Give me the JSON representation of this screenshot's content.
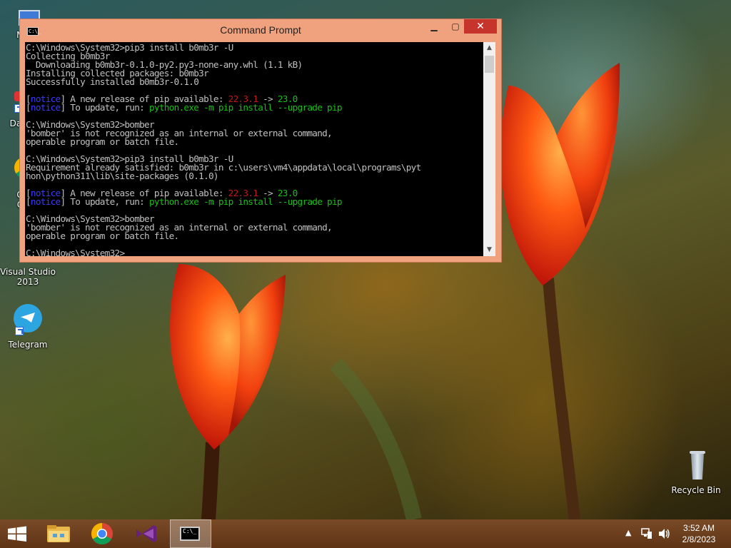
{
  "desktop": {
    "icons": [
      {
        "label": "My C"
      },
      {
        "label": "Data"
      },
      {
        "label": "G"
      },
      {
        "label": "C"
      },
      {
        "label": "Visual Studio"
      },
      {
        "label": "2013"
      },
      {
        "label": "Telegram"
      },
      {
        "label": "Recycle Bin"
      }
    ]
  },
  "window": {
    "title": "Command Prompt",
    "icon_text": "C:\\_",
    "minimize_glyph": "▁",
    "maximize_glyph": "▢",
    "close_glyph": "✕",
    "scroll_up_glyph": "▲",
    "scroll_down_glyph": "▼",
    "lines": [
      {
        "segs": [
          {
            "t": "C:\\Windows\\System32>pip3 install b0mb3r -U"
          }
        ]
      },
      {
        "segs": [
          {
            "t": "Collecting b0mb3r"
          }
        ]
      },
      {
        "segs": [
          {
            "t": "  Downloading b0mb3r-0.1.0-py2.py3-none-any.whl (1.1 kB)"
          }
        ]
      },
      {
        "segs": [
          {
            "t": "Installing collected packages: b0mb3r"
          }
        ]
      },
      {
        "segs": [
          {
            "t": "Successfully installed b0mb3r-0.1.0"
          }
        ]
      },
      {
        "segs": [
          {
            "t": ""
          }
        ]
      },
      {
        "segs": [
          {
            "t": "["
          },
          {
            "t": "notice",
            "c": "notice"
          },
          {
            "t": "] A new release of pip available: "
          },
          {
            "t": "22.3.1",
            "c": "red"
          },
          {
            "t": " -> "
          },
          {
            "t": "23.0",
            "c": "green"
          }
        ]
      },
      {
        "segs": [
          {
            "t": "["
          },
          {
            "t": "notice",
            "c": "notice"
          },
          {
            "t": "] To update, run: "
          },
          {
            "t": "python.exe -m pip install --upgrade pip",
            "c": "green"
          }
        ]
      },
      {
        "segs": [
          {
            "t": ""
          }
        ]
      },
      {
        "segs": [
          {
            "t": "C:\\Windows\\System32>bomber"
          }
        ]
      },
      {
        "segs": [
          {
            "t": "'bomber' is not recognized as an internal or external command,"
          }
        ]
      },
      {
        "segs": [
          {
            "t": "operable program or batch file."
          }
        ]
      },
      {
        "segs": [
          {
            "t": ""
          }
        ]
      },
      {
        "segs": [
          {
            "t": "C:\\Windows\\System32>pip3 install b0mb3r -U"
          }
        ]
      },
      {
        "segs": [
          {
            "t": "Requirement already satisfied: b0mb3r in c:\\users\\vm4\\appdata\\local\\programs\\pyt"
          }
        ]
      },
      {
        "segs": [
          {
            "t": "hon\\python311\\lib\\site-packages (0.1.0)"
          }
        ]
      },
      {
        "segs": [
          {
            "t": ""
          }
        ]
      },
      {
        "segs": [
          {
            "t": "["
          },
          {
            "t": "notice",
            "c": "notice"
          },
          {
            "t": "] A new release of pip available: "
          },
          {
            "t": "22.3.1",
            "c": "red"
          },
          {
            "t": " -> "
          },
          {
            "t": "23.0",
            "c": "green"
          }
        ]
      },
      {
        "segs": [
          {
            "t": "["
          },
          {
            "t": "notice",
            "c": "notice"
          },
          {
            "t": "] To update, run: "
          },
          {
            "t": "python.exe -m pip install --upgrade pip",
            "c": "green"
          }
        ]
      },
      {
        "segs": [
          {
            "t": ""
          }
        ]
      },
      {
        "segs": [
          {
            "t": "C:\\Windows\\System32>bomber"
          }
        ]
      },
      {
        "segs": [
          {
            "t": "'bomber' is not recognized as an internal or external command,"
          }
        ]
      },
      {
        "segs": [
          {
            "t": "operable program or batch file."
          }
        ]
      },
      {
        "segs": [
          {
            "t": ""
          }
        ]
      },
      {
        "segs": [
          {
            "t": "C:\\Windows\\System32>"
          }
        ]
      }
    ]
  },
  "taskbar": {
    "cmd_icon_text": "C:\\_",
    "tray_arrow_glyph": "▲",
    "clock_time": "3:52 AM",
    "clock_date": "2/8/2023"
  },
  "colors": {
    "titlebar": "#f0a27f",
    "close": "#c7342c",
    "notice": "#3a3aff",
    "red": "#c01818",
    "green": "#16c016",
    "taskbar": "#6a3c1c"
  }
}
